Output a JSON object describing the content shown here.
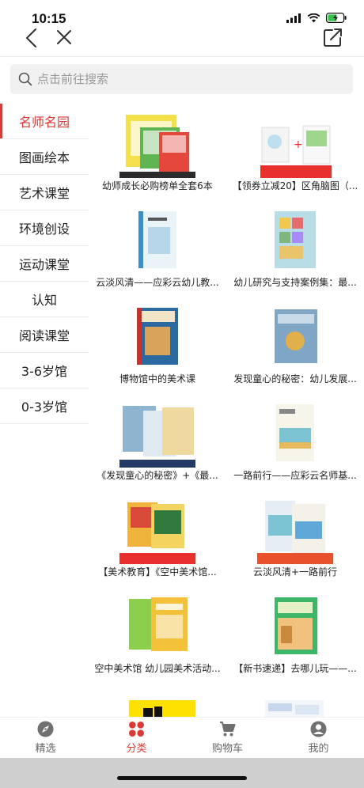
{
  "status": {
    "time": "10:15"
  },
  "search": {
    "placeholder": "点击前往搜索"
  },
  "sidebar": {
    "items": [
      {
        "label": "名师名园",
        "active": true
      },
      {
        "label": "图画绘本"
      },
      {
        "label": "艺术课堂"
      },
      {
        "label": "环境创设"
      },
      {
        "label": "运动课堂"
      },
      {
        "label": "认知"
      },
      {
        "label": "阅读课堂"
      },
      {
        "label": "3-6岁馆"
      },
      {
        "label": "0-3岁馆"
      }
    ]
  },
  "products": [
    {
      "title": "幼师成长必购榜单全套6本"
    },
    {
      "title": "【领券立减20】区角脑图（..."
    },
    {
      "title": "云淡风清——应彩云幼儿教..."
    },
    {
      "title": "幼儿研究与支持案例集：最..."
    },
    {
      "title": "博物馆中的美术课"
    },
    {
      "title": "发现童心的秘密：幼儿发展..."
    },
    {
      "title": "《发现童心的秘密》+《最..."
    },
    {
      "title": "一路前行——应彩云名师基..."
    },
    {
      "title": "【美术教育】《空中美术馆..."
    },
    {
      "title": "云淡风清+一路前行"
    },
    {
      "title": "空中美术馆 幼儿园美术活动..."
    },
    {
      "title": "【新书速递】去哪儿玩——..."
    }
  ],
  "tabbar": {
    "items": [
      {
        "label": "精选",
        "icon": "compass-icon"
      },
      {
        "label": "分类",
        "icon": "grid-icon",
        "active": true
      },
      {
        "label": "购物车",
        "icon": "cart-icon"
      },
      {
        "label": "我的",
        "icon": "user-icon"
      }
    ]
  },
  "colors": {
    "accent": "#d93a35"
  }
}
